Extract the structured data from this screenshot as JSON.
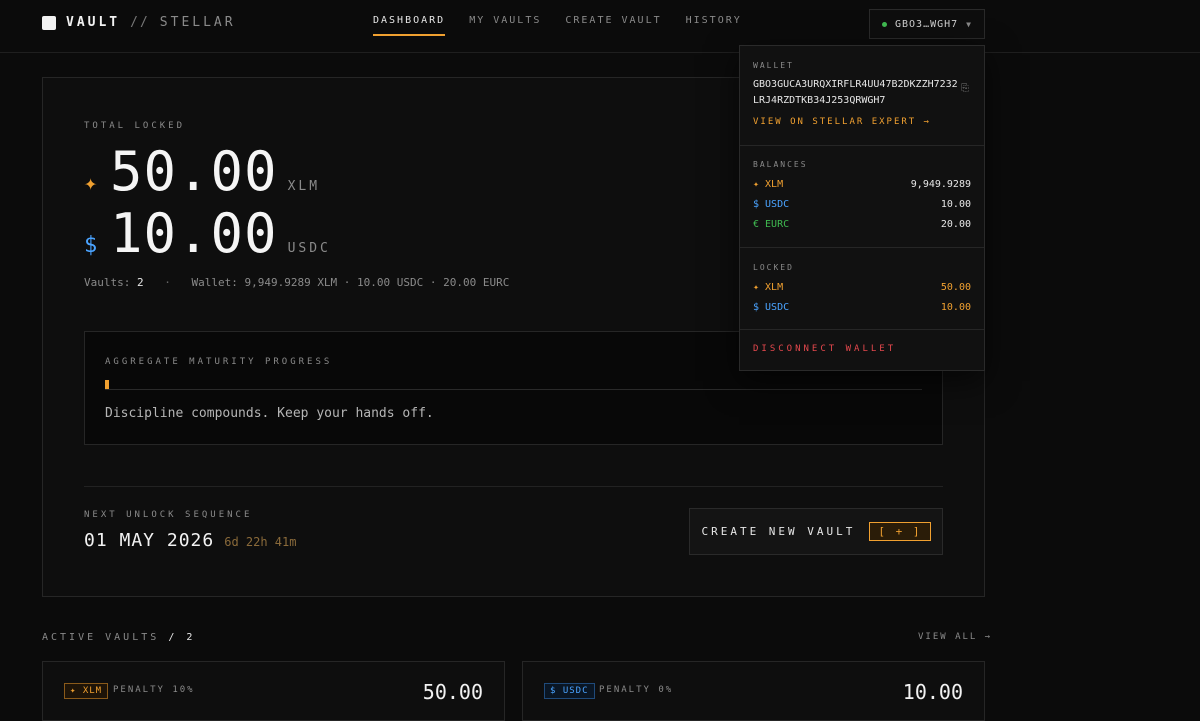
{
  "brand": {
    "name": "VAULT",
    "separator": "//",
    "network": "STELLAR"
  },
  "nav": [
    {
      "label": "DASHBOARD",
      "active": true
    },
    {
      "label": "MY VAULTS",
      "active": false
    },
    {
      "label": "CREATE VAULT",
      "active": false
    },
    {
      "label": "HISTORY",
      "active": false
    }
  ],
  "wallet_button": {
    "label": "GBO3…WGH7",
    "status_color": "#3fb950"
  },
  "summary_card": {
    "total_label": "TOTAL LOCKED",
    "amounts": [
      {
        "icon": "✦",
        "value": "50.00",
        "unit": "XLM"
      },
      {
        "icon": "$",
        "value": "10.00",
        "unit": "USDC"
      }
    ],
    "vaults_label": "Vaults:",
    "vaults_count": "2",
    "wallet_line": "Wallet: 9,949.9289 XLM · 10.00 USDC · 20.00 EURC",
    "progress_label": "AGGREGATE MATURITY PROGRESS",
    "progress_fraction": 0.005,
    "motto": "Discipline compounds. Keep your hands off.",
    "next_label": "NEXT UNLOCK SEQUENCE",
    "next_date": "01 MAY 2026",
    "next_countdown": "6d 22h 41m",
    "create_button": "CREATE NEW VAULT",
    "create_badge": "[ + ]"
  },
  "active_vaults": {
    "label": "ACTIVE VAULTS",
    "sep": "/",
    "count": "2",
    "view_all": "VIEW ALL →",
    "cards": [
      {
        "asset": "✦ XLM",
        "penalty": "PENALTY 10%",
        "amount": "50.00"
      },
      {
        "asset": "$ USDC",
        "penalty": "PENALTY 0%",
        "amount": "10.00"
      }
    ]
  },
  "dropdown": {
    "wallet_label": "WALLET",
    "address": "GBO3GUCA3URQXIRFLR4UU47B2DKZZH7232LRJ4RZDTKB34J253QRWGH7",
    "copy_icon": "⎘",
    "explorer_link": "VIEW ON STELLAR EXPERT →",
    "balances_label": "BALANCES",
    "balances": [
      {
        "asset": "✦ XLM",
        "value": "9,949.9289"
      },
      {
        "asset": "$ USDC",
        "value": "10.00"
      },
      {
        "asset": "€ EURC",
        "value": "20.00"
      }
    ],
    "locked_label": "LOCKED",
    "locked": [
      {
        "asset": "✦ XLM",
        "value": "50.00"
      },
      {
        "asset": "$ USDC",
        "value": "10.00"
      }
    ],
    "disconnect": "DISCONNECT WALLET"
  },
  "colors": {
    "accent": "#f0a030",
    "usdc": "#4aa3ff",
    "eurc": "#3fb950",
    "danger": "#e5484d"
  }
}
